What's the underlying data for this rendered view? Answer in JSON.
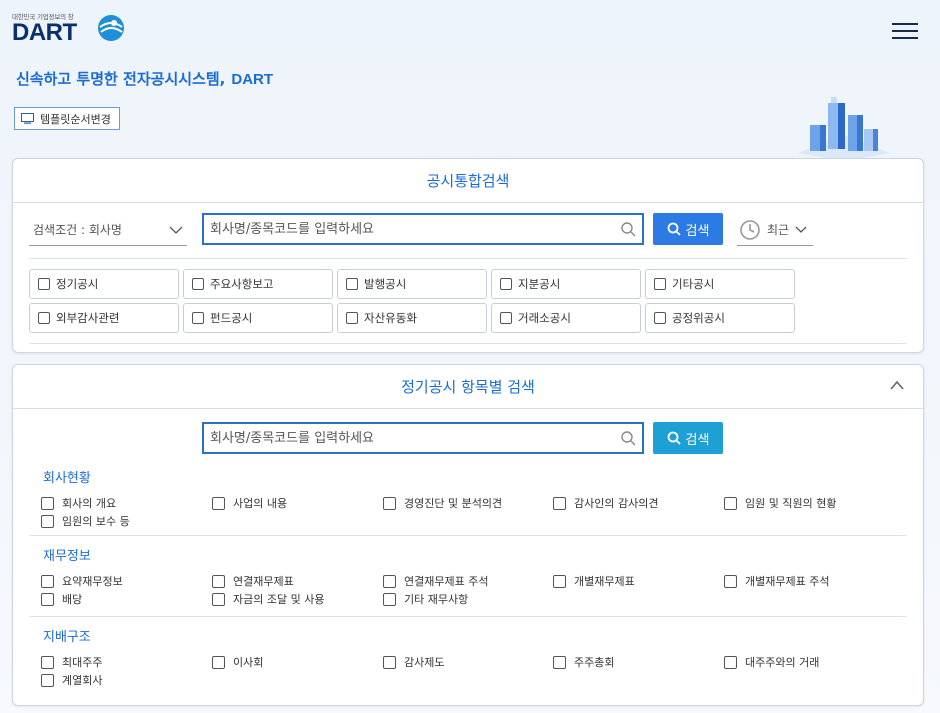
{
  "header": {
    "logo_small": "대한민국 기업정보의 창",
    "logo_text": "DART",
    "tagline": "신속하고 투명한 전자공시시스템,",
    "tagline_brand": "DART",
    "template_button": "템플릿순서변경"
  },
  "integrated": {
    "title": "공시통합검색",
    "condition_label": "검색조건 : 회사명",
    "search_placeholder": "회사명/종목코드를 입력하세요",
    "search_button": "검색",
    "recent_label": "최근",
    "types": [
      [
        "정기공시",
        "주요사항보고",
        "발행공시",
        "지분공시",
        "기타공시"
      ],
      [
        "외부감사관련",
        "펀드공시",
        "자산유동화",
        "거래소공시",
        "공정위공시"
      ]
    ]
  },
  "periodic": {
    "title": "정기공시 항목별 검색",
    "search_placeholder": "회사명/종목코드를 입력하세요",
    "search_button": "검색",
    "sections": [
      {
        "title": "회사현황",
        "items": [
          "회사의 개요",
          "사업의 내용",
          "경영진단 및 분석의견",
          "감사인의 감사의견",
          "임원 및 직원의 현황",
          "임원의 보수 등"
        ]
      },
      {
        "title": "재무정보",
        "items": [
          "요약재무정보",
          "연결재무제표",
          "연결재무제표 주석",
          "개별재무제표",
          "개별재무제표 주석",
          "배당",
          "자금의 조달 및 사용",
          "기타 재무사항"
        ]
      },
      {
        "title": "지배구조",
        "items": [
          "최대주주",
          "이사회",
          "감사제도",
          "주주총회",
          "대주주와의 거래",
          "계열회사"
        ]
      }
    ]
  },
  "colors": {
    "accent": "#1b6bd6",
    "button_blue": "#2c7be5",
    "button_teal": "#1fa0d4",
    "logo_navy": "#0b2f6b"
  },
  "icons": [
    "menu-icon",
    "monitor-icon",
    "search-icon",
    "magnifier-icon",
    "clock-icon",
    "chevron-down-icon",
    "chevron-up-icon"
  ]
}
